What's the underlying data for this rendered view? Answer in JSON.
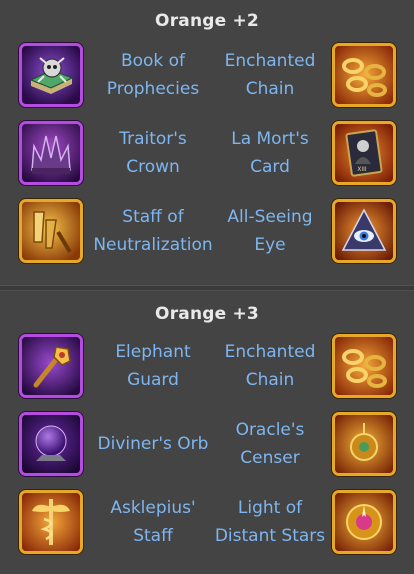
{
  "sections": [
    {
      "title": "Orange +2",
      "rows": [
        {
          "left": {
            "name_line1": "Book of",
            "name_line2": "Prophecies",
            "icon": "book-of-prophecies-icon",
            "frame": "purple"
          },
          "right": {
            "name_line1": "Enchanted",
            "name_line2": "Chain",
            "icon": "enchanted-chain-icon",
            "frame": "gold"
          }
        },
        {
          "left": {
            "name_line1": "Traitor's",
            "name_line2": "Crown",
            "icon": "traitors-crown-icon",
            "frame": "purple"
          },
          "right": {
            "name_line1": "La Mort's",
            "name_line2": "Card",
            "icon": "la-morts-card-icon",
            "frame": "gold",
            "card_label": "XIII"
          }
        },
        {
          "left": {
            "name_line1": "Staff of",
            "name_line2": "Neutralization",
            "icon": "staff-of-neutralization-icon",
            "frame": "gold"
          },
          "right": {
            "name_line1": "All-Seeing",
            "name_line2": "Eye",
            "icon": "all-seeing-eye-icon",
            "frame": "gold"
          }
        }
      ]
    },
    {
      "title": "Orange +3",
      "rows": [
        {
          "left": {
            "name_line1": "Elephant",
            "name_line2": "Guard",
            "icon": "elephant-guard-icon",
            "frame": "purple"
          },
          "right": {
            "name_line1": "Enchanted",
            "name_line2": "Chain",
            "icon": "enchanted-chain-icon",
            "frame": "gold"
          }
        },
        {
          "left": {
            "name_line1": "Diviner's Orb",
            "icon": "diviners-orb-icon",
            "frame": "purple"
          },
          "right": {
            "name_line1": "Oracle's",
            "name_line2": "Censer",
            "icon": "oracles-censer-icon",
            "frame": "gold"
          }
        },
        {
          "left": {
            "name_line1": "Asklepius'",
            "name_line2": "Staff",
            "icon": "asklepius-staff-icon",
            "frame": "gold"
          },
          "right": {
            "name_line1": "Light of",
            "name_line2": "Distant Stars",
            "icon": "light-of-distant-stars-icon",
            "frame": "gold"
          }
        }
      ]
    }
  ],
  "colors": {
    "background": "#444445",
    "title_text": "#e9e9e9",
    "item_text": "#7db6f0",
    "purple_frame": "#b54be0",
    "gold_frame": "#e6a826"
  }
}
